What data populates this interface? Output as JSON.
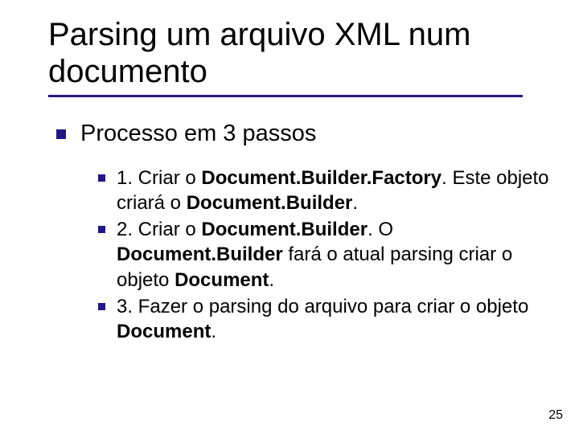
{
  "title": "Parsing um arquivo XML num documento",
  "level1": {
    "text": "Processo em 3 passos"
  },
  "steps": [
    {
      "prefix": "1. Criar o ",
      "bold1": "Document.Builder.Factory",
      "mid1": ". Este objeto criará o ",
      "bold2": "Document.Builder",
      "suffix": "."
    },
    {
      "prefix": "2. Criar o ",
      "bold1": "Document.Builder",
      "mid1": ". O ",
      "bold2": "Document.Builder",
      "mid2": " fará o  atual parsing criar o objeto ",
      "bold3": "Document",
      "suffix": "."
    },
    {
      "prefix": "3. Fazer o parsing do arquivo para criar o objeto ",
      "bold1": "Document",
      "suffix": "."
    }
  ],
  "pagenum": "25"
}
